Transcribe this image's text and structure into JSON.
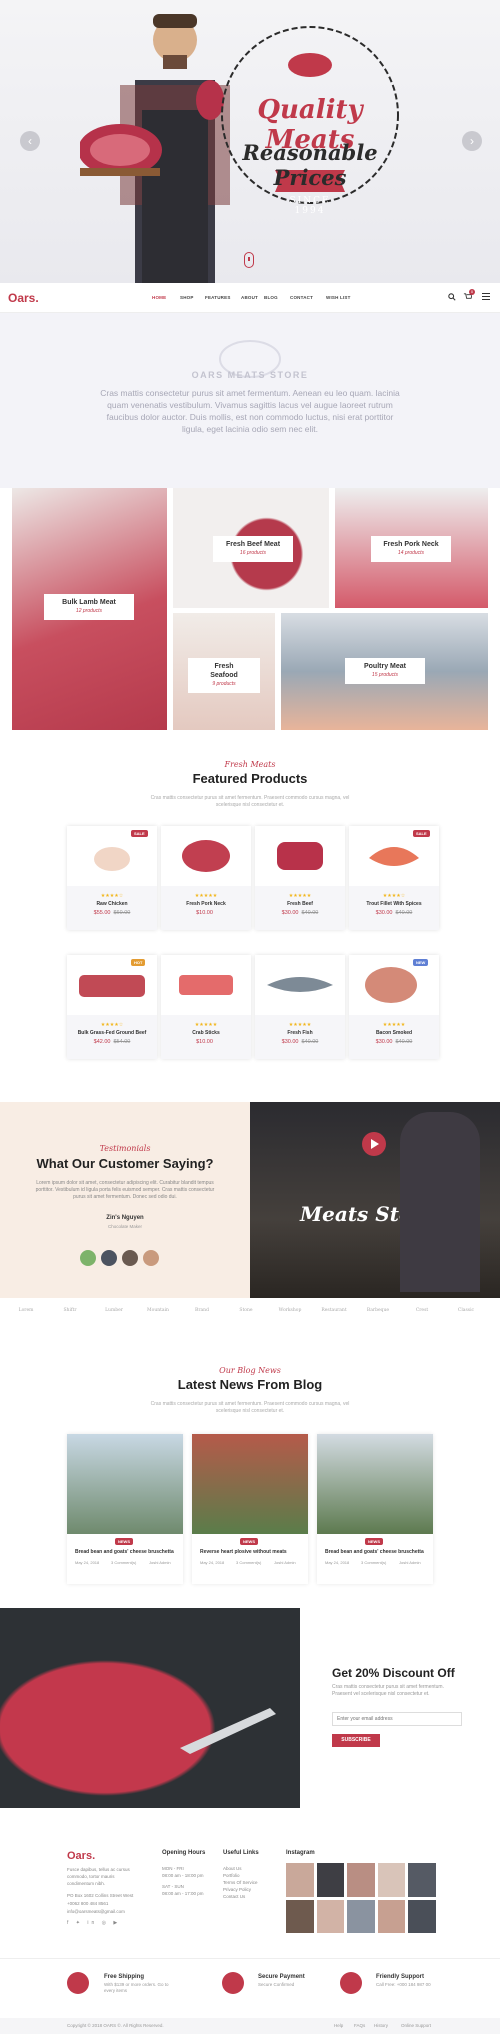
{
  "hero": {
    "title1": "Quality Meats",
    "title2": "Reasonable Prices",
    "since": "SINCE 1994",
    "prev_arrow": "‹",
    "next_arrow": "›"
  },
  "nav": {
    "logo": "Oars.",
    "items": [
      "HOME",
      "SHOP",
      "FEATURES",
      "ABOUT",
      "BLOG",
      "CONTACT",
      "WISH LIST"
    ],
    "cart_count": "0"
  },
  "about": {
    "title": "OARS MEATS STORE",
    "text": "Cras mattis consectetur purus sit amet fermentum. Aenean eu leo quam. lacinia quam venenatis vestibulum. Vivamus sagittis lacus vel augue laoreet rutrum faucibus dolor auctor. Duis mollis, est non commodo luctus, nisi erat porttitor ligula, eget lacinia odio sem nec elit."
  },
  "categories": [
    {
      "name": "Bulk Lamb Meat",
      "count": "12 products"
    },
    {
      "name": "Fresh Beef Meat",
      "count": "16 products"
    },
    {
      "name": "Fresh Pork Neck",
      "count": "14 products"
    },
    {
      "name": "Fresh Seafood",
      "count": "9 products"
    },
    {
      "name": "Poultry Meat",
      "count": "15 products"
    }
  ],
  "featured": {
    "script": "Fresh Meats",
    "title": "Featured Products",
    "sub": "Cras mattis consectetur purus sit amet fermentum. Praesent commodo cursus magna, vel scelerisque nisl consectetur et."
  },
  "products": [
    {
      "name": "Raw Chicken",
      "price": "$55.00",
      "old": "$60.00",
      "stars": "★★★★☆"
    },
    {
      "name": "Fresh Pork Neck",
      "price": "$10.00",
      "old": "",
      "stars": "★★★★★"
    },
    {
      "name": "Fresh Beef",
      "price": "$30.00",
      "old": "$40.00",
      "stars": "★★★★★"
    },
    {
      "name": "Trout Fillet With Spices",
      "price": "$30.00",
      "old": "$40.00",
      "stars": "★★★★☆"
    },
    {
      "name": "Bulk Grass-Fed Ground Beef",
      "price": "$42.00",
      "old": "$54.00",
      "stars": "★★★★☆"
    },
    {
      "name": "Crab Sticks",
      "price": "$10.00",
      "old": "",
      "stars": "★★★★★"
    },
    {
      "name": "Fresh Fish",
      "price": "$30.00",
      "old": "$40.00",
      "stars": "★★★★★"
    },
    {
      "name": "Bacon Smoked",
      "price": "$30.00",
      "old": "$40.00",
      "stars": "★★★★★"
    }
  ],
  "testimonials": {
    "script": "Testimonials",
    "title": "What Our Customer Saying?",
    "text": "Lorem ipsum dolor sit amet, consectetur adipiscing elit. Curabitur blandit tempus porttitor. Vestibulum id ligula porta felis euismod semper. Cras mattis consectetur purus sit amet fermentum. Donec sed odio dui.",
    "author": "Zin's Nguyen",
    "role": "Chocolate Maker",
    "video_brand": "Meats Store"
  },
  "logos": [
    "Lorem",
    "Shiftr",
    "Lumber",
    "Mountain",
    "Brand",
    "Stone",
    "Workshop",
    "Restaurant",
    "Barbeque",
    "Crest",
    "Classic"
  ],
  "blog": {
    "script": "Our Blog News",
    "title": "Latest News From Blog",
    "sub": "Cras mattis consectetur purus sit amet fermentum. Praesent commodo cursus magna, vel scelerisque nisl consectetur et.",
    "posts": [
      {
        "badge": "NEWS",
        "title": "Bread bean and goats' cheese bruschetta",
        "date": "May 24, 2018",
        "comments": "3 Comment(s)",
        "author": "Joshi Admin"
      },
      {
        "badge": "NEWS",
        "title": "Reverse heart plosive without meats",
        "date": "May 24, 2018",
        "comments": "3 Comment(s)",
        "author": "Joshi Admin"
      },
      {
        "badge": "NEWS",
        "title": "Bread bean and goats' cheese bruschetta",
        "date": "May 24, 2018",
        "comments": "3 Comment(s)",
        "author": "Joshi Admin"
      }
    ]
  },
  "discount": {
    "title": "Get 20% Discount Off",
    "sub": "Cras mattis consectetur purus sit amet fermentum. Praesent vel scelerisque nisl consectetur et.",
    "placeholder": "Enter your email address",
    "button": "SUBSCRIBE"
  },
  "footer": {
    "logo": "Oars.",
    "about": "Fusce dapibus, tellus ac cursus commodo, tortor mauris condimentum nibh.",
    "address": "PO Box 1602 Collins Street West",
    "phone": "+0062 800 484 8561",
    "email": "info@oarsmeats@gmail.com",
    "hours_title": "Opening Hours",
    "hours": [
      "MON - FRI",
      "08:00 am - 18:00 pm",
      "SAT - SUN",
      "08:00 am - 17:00 pm"
    ],
    "links_title": "Useful Links",
    "links": [
      "About Us",
      "Portfolio",
      "Terms Of Service",
      "Privacy Policy",
      "Contact Us"
    ],
    "insta_title": "Instagram",
    "features": [
      {
        "title": "Free Shipping",
        "sub": "With $139 or more orders. Go to every items"
      },
      {
        "title": "Secure Payment",
        "sub": "Secure Confirmed"
      },
      {
        "title": "Friendly Support",
        "sub": "Call Free: +000 184 987 00"
      }
    ],
    "copyright": "Copyright © 2018 OARS ©. All Rights Reserved.",
    "bottom_links": [
      "Help",
      "FAQs",
      "History",
      "Online Support"
    ]
  },
  "colors": {
    "accent": "#c0394a",
    "soft_bg": "#f3f3f8"
  }
}
